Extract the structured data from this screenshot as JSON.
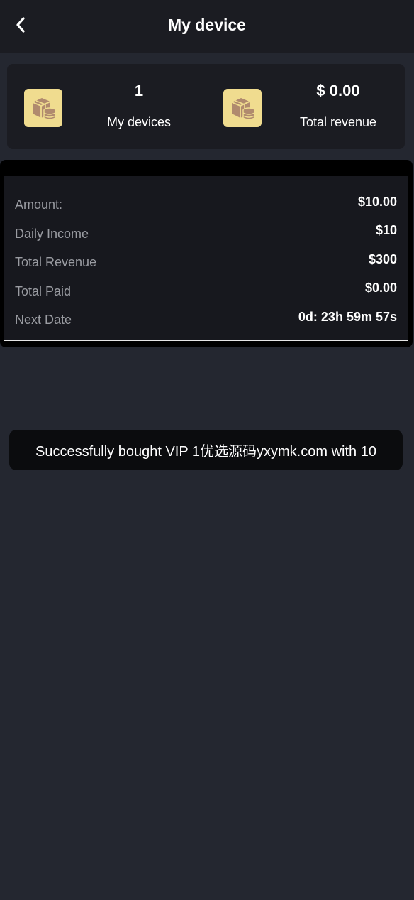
{
  "header": {
    "title": "My device"
  },
  "summary": {
    "devices_value": "1",
    "devices_label": "My devices",
    "revenue_value": "$ 0.00",
    "revenue_label": "Total revenue",
    "icon": "device-coin-icon"
  },
  "device": {
    "rows": [
      {
        "label": "Amount:",
        "value": "$10.00"
      },
      {
        "label": "Daily Income",
        "value": "$10"
      },
      {
        "label": "Total Revenue",
        "value": "$300"
      },
      {
        "label": "Total Paid",
        "value": "$0.00"
      },
      {
        "label": "Next Date",
        "value": "0d: 23h 59m 57s"
      }
    ]
  },
  "toast": {
    "message": "Successfully bought VIP 1优选源码yxymk.com with 10"
  },
  "colors": {
    "background": "#242730",
    "header": "#1b1c22",
    "icon_bg": "#f0dc8f",
    "icon_fg": "#b08a6e"
  }
}
